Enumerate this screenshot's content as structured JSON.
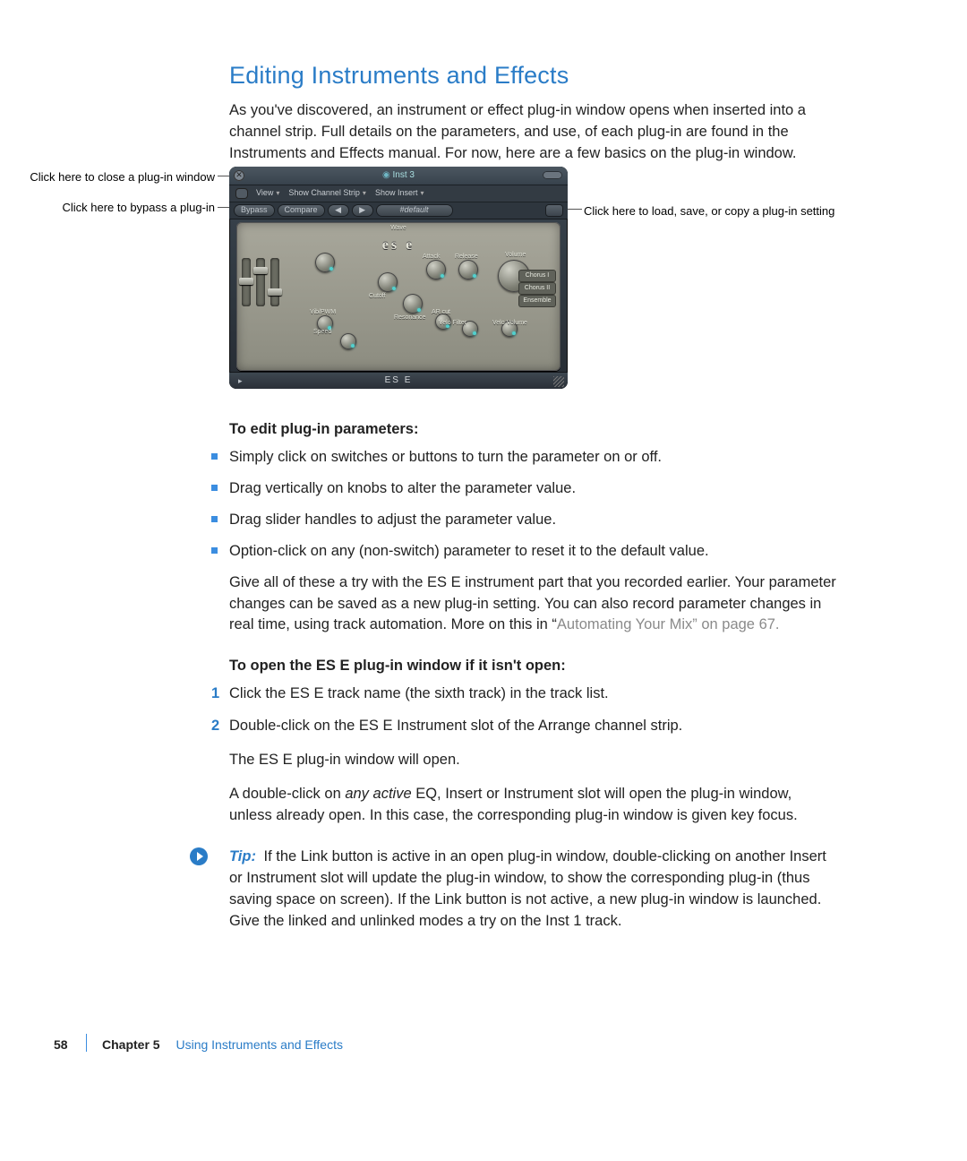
{
  "section": {
    "title": "Editing Instruments and Effects",
    "intro": "As you've discovered, an instrument or effect plug-in window opens when inserted into a channel strip. Full details on the parameters, and use, of each plug-in are found in the Instruments and Effects manual. For now, here are a few basics on the plug-in window."
  },
  "callouts": {
    "close": "Click here to close a plug-in window",
    "bypass": "Click here to bypass a plug-in",
    "load": "Click here to load, save, or copy a plug-in setting"
  },
  "plugin": {
    "title": "Inst 3",
    "toolbar1": {
      "view": "View",
      "show_channel": "Show Channel Strip",
      "show_insert": "Show Insert"
    },
    "toolbar2": {
      "bypass": "Bypass",
      "compare": "Compare",
      "nav_prev": "◀",
      "nav_next": "▶",
      "preset": "#default"
    },
    "brand": "es e",
    "labels": {
      "wave": "Wave",
      "cutoff": "Cutoff",
      "resonance": "Resonance",
      "attack": "Attack",
      "release": "Release",
      "volume": "Volume",
      "vibpwm": "Vib/PWM",
      "speed": "Speed",
      "arcut": "AR cut",
      "velofilter": "Velo Filter",
      "velovolume": "Velo Volume",
      "chorus1": "Chorus I",
      "chorus2": "Chorus II",
      "ensemble": "Ensemble"
    },
    "footer": "ES E",
    "footer_play": "▸"
  },
  "body": {
    "subhead1": "To edit plug-in parameters:",
    "bullets": [
      "Simply click on switches or buttons to turn the parameter on or off.",
      "Drag vertically on knobs to alter the parameter value.",
      "Drag slider handles to adjust the parameter value.",
      "Option-click on any (non-switch) parameter to reset it to the default value."
    ],
    "after_bullets_1a": "Give all of these a try with the ES E instrument part that you recorded earlier. Your parameter changes can be saved as a new plug-in setting. You can also record parameter changes in real time, using track automation. More on this in “",
    "after_bullets_link": "Automating Your Mix",
    "after_bullets_1b": "” on page 67.",
    "subhead2": "To open the ES E plug-in window if it isn't open:",
    "steps": [
      "Click the ES E track name (the sixth track) in the track list.",
      "Double-click on the ES E Instrument slot of the Arrange channel strip."
    ],
    "after_steps_1": "The ES E plug-in window will open.",
    "after_steps_2a": "A double-click on ",
    "after_steps_2_em": "any active",
    "after_steps_2b": " EQ, Insert or Instrument slot will open the plug-in window, unless already open. In this case, the corresponding plug-in window is given key focus.",
    "tip_label": "Tip:",
    "tip_text": "  If the Link button is active in an open plug-in window, double-clicking on another Insert or Instrument slot will update the plug-in window, to show the corresponding plug-in (thus saving space on screen). If the Link button is not active, a new plug-in window is launched. Give the linked and unlinked modes a try on the Inst 1 track."
  },
  "footer": {
    "page": "58",
    "chapter_label": "Chapter 5",
    "chapter_title": "Using Instruments and Effects"
  }
}
